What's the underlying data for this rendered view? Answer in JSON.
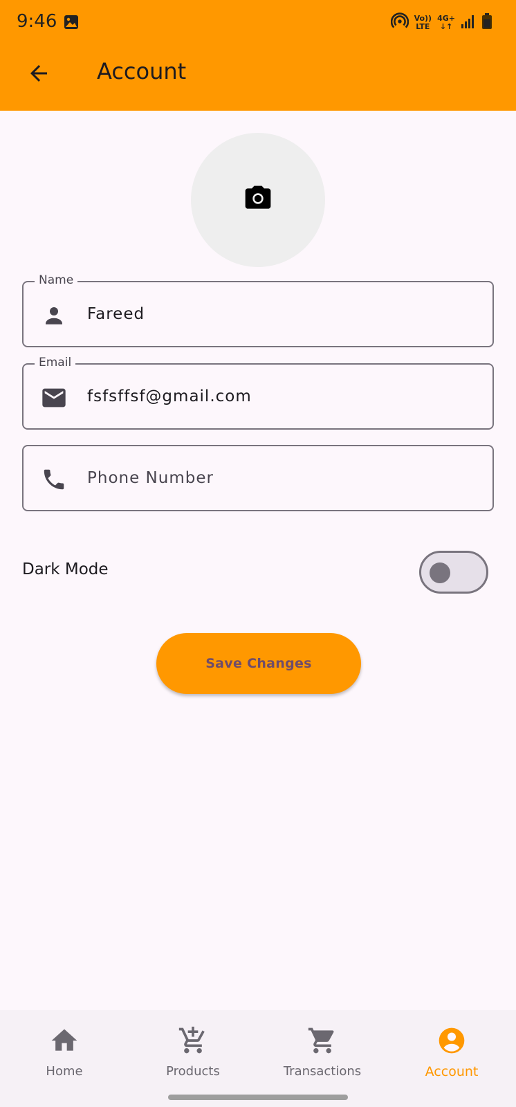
{
  "status_bar": {
    "time": "9:46",
    "network_top": "Vo))",
    "network_bottom": "LTE",
    "signal_type": "4G+"
  },
  "app_bar": {
    "title": "Account",
    "back_icon": "arrow-back-icon",
    "background_color": "#ff9800"
  },
  "profile": {
    "avatar_icon": "camera-icon"
  },
  "form": {
    "name": {
      "label": "Name",
      "value": "Fareed",
      "icon": "person-icon"
    },
    "email": {
      "label": "Email",
      "value": "fsfsffsf@gmail.com",
      "icon": "mail-icon"
    },
    "phone": {
      "placeholder": "Phone Number",
      "value": "",
      "icon": "phone-icon"
    }
  },
  "settings": {
    "dark_mode_label": "Dark Mode",
    "dark_mode_on": false
  },
  "actions": {
    "save_label": "Save Changes"
  },
  "bottom_nav": {
    "items": [
      {
        "label": "Home",
        "icon": "home-icon",
        "active": false
      },
      {
        "label": "Products",
        "icon": "cart-add-icon",
        "active": false
      },
      {
        "label": "Transactions",
        "icon": "cart-icon",
        "active": false
      },
      {
        "label": "Account",
        "icon": "account-circle-icon",
        "active": true
      }
    ],
    "active_color": "#ff9800"
  }
}
